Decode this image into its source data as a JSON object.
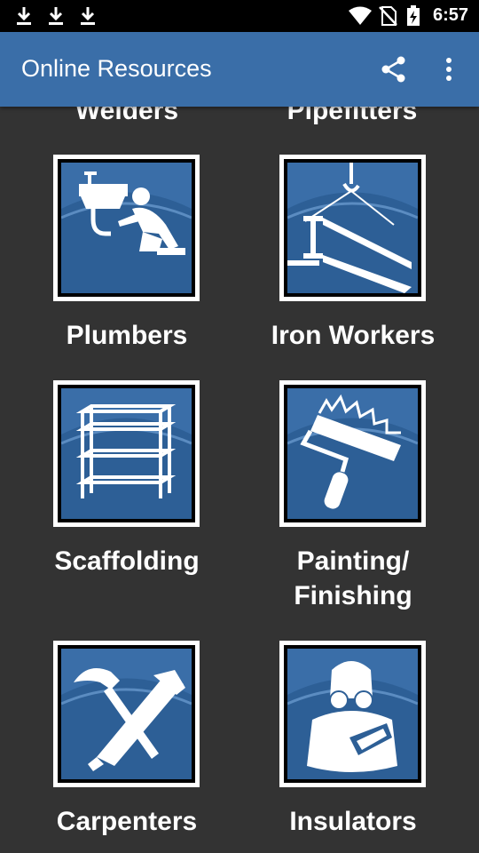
{
  "status_bar": {
    "time": "6:57",
    "icons": [
      "download-icon",
      "download-icon",
      "download-icon",
      "wifi-icon",
      "no-sim-icon",
      "battery-charging-icon"
    ]
  },
  "app_bar": {
    "title": "Online Resources",
    "share_icon": "share-icon",
    "more_icon": "more-vert-icon"
  },
  "grid": {
    "partial_row": [
      "Welders",
      "Pipefitters"
    ],
    "items": [
      {
        "label": "Plumbers",
        "icon": "plumber-icon"
      },
      {
        "label": "Iron Workers",
        "icon": "iron-worker-icon"
      },
      {
        "label": "Scaffolding",
        "icon": "scaffolding-icon"
      },
      {
        "label_line1": "Painting/",
        "label_line2": "Finishing",
        "icon": "paint-roller-icon"
      },
      {
        "label": "Carpenters",
        "icon": "carpenter-icon"
      },
      {
        "label": "Insulators",
        "icon": "insulator-icon"
      }
    ]
  },
  "colors": {
    "app_bar": "#3a6ea8",
    "background": "#333333",
    "tile_art": "#3a6ea8"
  }
}
